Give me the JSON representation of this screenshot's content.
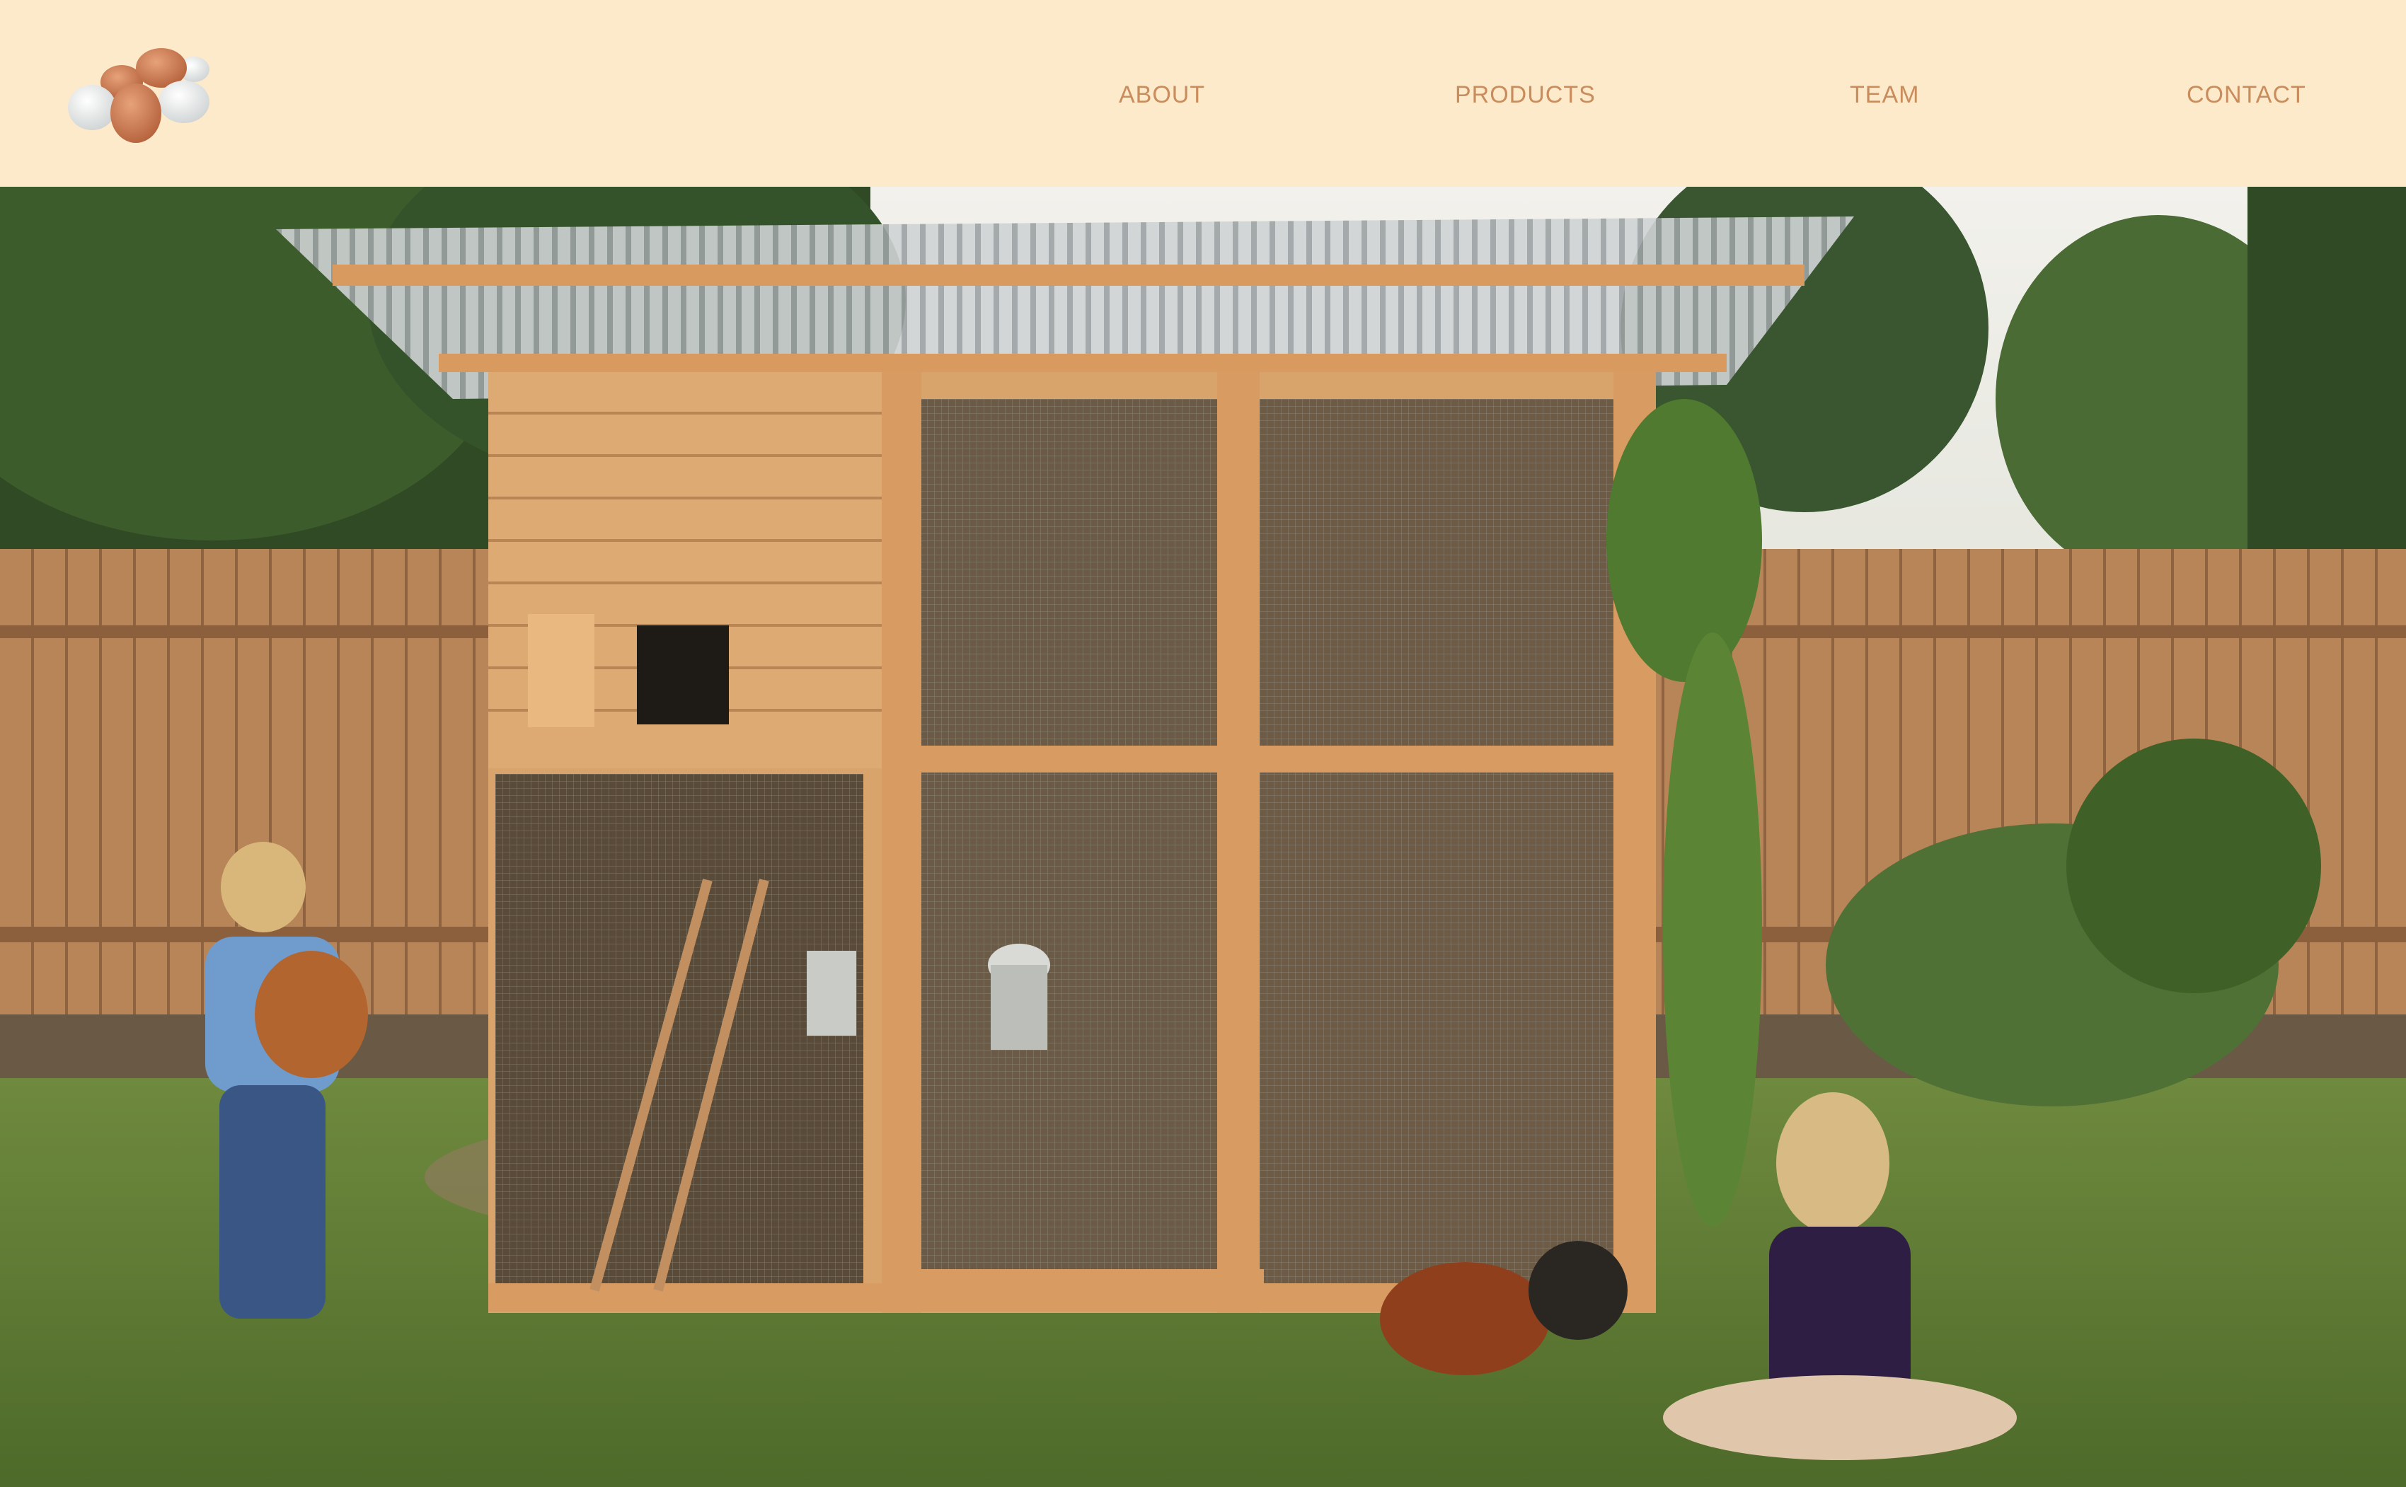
{
  "logo": {
    "icon": "eggs-logo-icon"
  },
  "nav": {
    "items": [
      {
        "label": "ABOUT"
      },
      {
        "label": "PRODUCTS"
      },
      {
        "label": "TEAM"
      },
      {
        "label": "CONTACT"
      }
    ]
  },
  "hero": {
    "image": "backyard-chicken-coop-photo"
  },
  "colors": {
    "header_bg": "#fdeacb",
    "nav_text": "#c98c5c"
  }
}
